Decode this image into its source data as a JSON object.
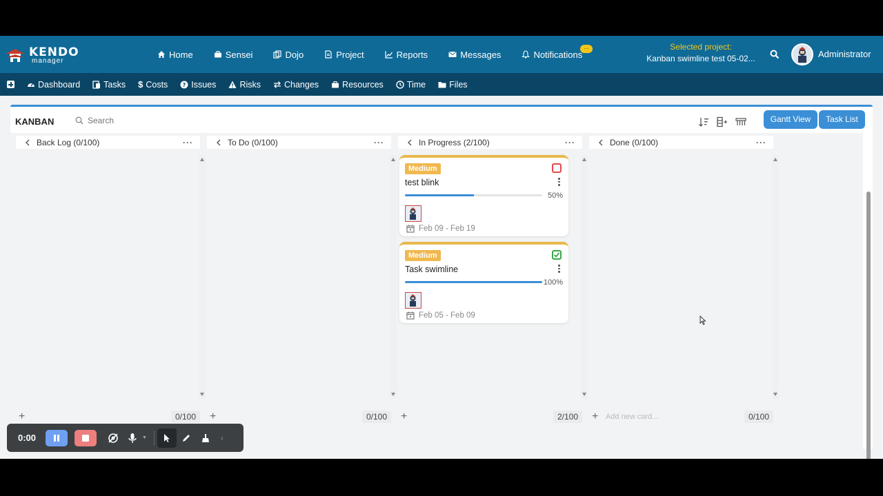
{
  "header": {
    "logo_line1": "KENDO",
    "logo_line2": "manager",
    "menu": [
      {
        "label": "Home",
        "icon": "home-icon"
      },
      {
        "label": "Sensei",
        "icon": "briefcase-icon"
      },
      {
        "label": "Dojo",
        "icon": "copy-icon"
      },
      {
        "label": "Project",
        "icon": "document-icon"
      },
      {
        "label": "Reports",
        "icon": "line-chart-icon"
      },
      {
        "label": "Messages",
        "icon": "envelope-icon"
      },
      {
        "label": "Notifications",
        "icon": "bell-icon"
      }
    ],
    "selected_project_label": "Selected project:",
    "selected_project_value": "Kanban swimline test 05-02...",
    "user_name": "Administrator"
  },
  "subnav": {
    "items": [
      {
        "label": "Dashboard",
        "icon": "dashboard-icon"
      },
      {
        "label": "Tasks",
        "icon": "tasks-icon"
      },
      {
        "label": "Costs",
        "icon": "dollar-icon"
      },
      {
        "label": "Issues",
        "icon": "question-icon"
      },
      {
        "label": "Risks",
        "icon": "warning-icon"
      },
      {
        "label": "Changes",
        "icon": "exchange-icon"
      },
      {
        "label": "Resources",
        "icon": "briefcase-icon"
      },
      {
        "label": "Time",
        "icon": "clock-icon"
      },
      {
        "label": "Files",
        "icon": "folder-icon"
      }
    ]
  },
  "kanban": {
    "title": "KANBAN",
    "search_placeholder": "Search",
    "gantt_button": "Gantt View",
    "tasklist_button": "Task List",
    "columns": [
      {
        "title": "Back Log (0/100)",
        "footer_count": "0/100",
        "add_text": ""
      },
      {
        "title": "To Do (0/100)",
        "footer_count": "0/100",
        "add_text": ""
      },
      {
        "title": "In Progress (2/100)",
        "footer_count": "2/100",
        "add_text": ""
      },
      {
        "title": "Done (0/100)",
        "footer_count": "0/100",
        "add_text": "Add new card..."
      }
    ],
    "cards": [
      {
        "priority": "Medium",
        "name": "test blink",
        "progress": 50,
        "progress_label": "50%",
        "dates": "Feb 09 - Feb 19",
        "status": "open",
        "status_color": "#e04a4a"
      },
      {
        "priority": "Medium",
        "name": "Task swimline",
        "progress": 100,
        "progress_label": "100%",
        "dates": "Feb 05 - Feb 09",
        "status": "done",
        "status_color": "#3aa64c"
      }
    ]
  },
  "recorder": {
    "time": "0:00"
  },
  "colors": {
    "topnav": "#0f6a97",
    "subnav": "#0b4566",
    "accent": "#3a8fd6",
    "priority_medium": "#f0b84e"
  }
}
